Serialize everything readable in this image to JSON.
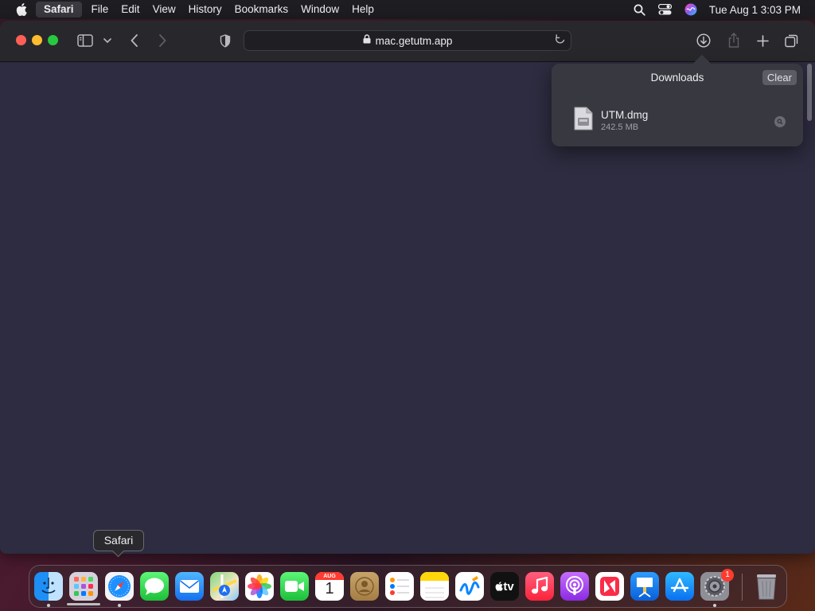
{
  "menubar": {
    "app_name": "Safari",
    "items": [
      "File",
      "Edit",
      "View",
      "History",
      "Bookmarks",
      "Window",
      "Help"
    ],
    "clock": "Tue Aug 1  3:03 PM",
    "status_icons": [
      "search-icon",
      "control-center-icon",
      "siri-icon"
    ]
  },
  "browser": {
    "url": "mac.getutm.app",
    "toolbar_icons": [
      "sidebar-icon",
      "chevron-down-icon",
      "back-icon",
      "forward-icon",
      "privacy-shield-icon",
      "downloads-icon",
      "share-icon",
      "new-tab-icon",
      "tab-overview-icon"
    ]
  },
  "downloads": {
    "title": "Downloads",
    "clear_label": "Clear",
    "items": [
      {
        "name": "UTM.dmg",
        "size": "242.5 MB"
      }
    ]
  },
  "dock": {
    "tooltip": "Safari",
    "calendar_month": "AUG",
    "calendar_day": "1",
    "tv_label": "tv",
    "settings_badge": "1",
    "apps": [
      "Finder",
      "Launchpad",
      "Safari",
      "Messages",
      "Mail",
      "Maps",
      "Photos",
      "FaceTime",
      "Calendar",
      "Contacts",
      "Reminders",
      "Notes",
      "Freeform",
      "TV",
      "Music",
      "Podcasts",
      "News",
      "Keynote",
      "App Store",
      "System Settings",
      "Trash"
    ]
  },
  "colors": {
    "page_background": "#2d2c40",
    "close": "#ff5f57",
    "minimize": "#febc2e",
    "zoom": "#28c840"
  }
}
